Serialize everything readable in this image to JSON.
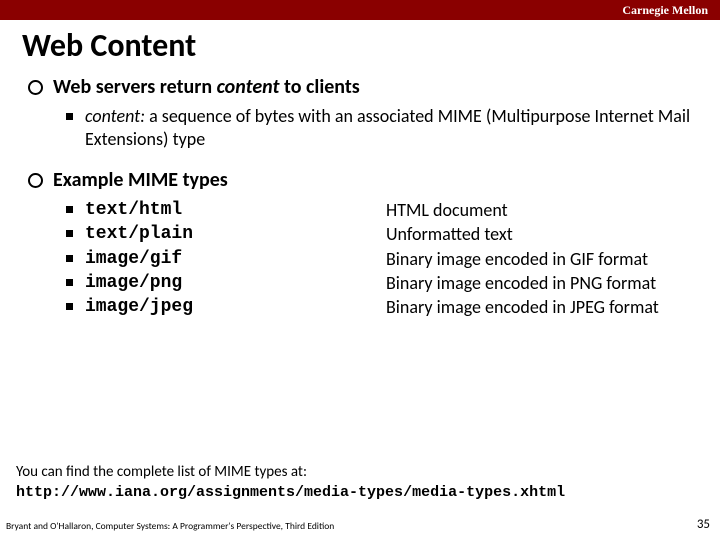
{
  "institution": "Carnegie Mellon",
  "title": "Web Content",
  "section1": {
    "heading_pre": "Web servers return ",
    "heading_em": "content",
    "heading_post": " to clients",
    "item_em": "content:",
    "item_rest": " a sequence of bytes with an associated MIME (Multipurpose Internet Mail Extensions) type"
  },
  "section2": {
    "heading": "Example MIME types",
    "rows": [
      {
        "type": "text/html",
        "desc": "HTML document"
      },
      {
        "type": "text/plain",
        "desc": "Unformatted text"
      },
      {
        "type": "image/gif",
        "desc": "Binary image encoded in GIF format"
      },
      {
        "type": "image/png",
        "desc": "Binary image encoded in PNG format"
      },
      {
        "type": "image/jpeg",
        "desc": "Binary image encoded in JPEG format"
      }
    ]
  },
  "footnote": {
    "text": "You can find the complete list of MIME types at:",
    "url": "http://www.iana.org/assignments/media-types/media-types.xhtml"
  },
  "footer_credit": "Bryant and O'Hallaron, Computer Systems: A Programmer's Perspective, Third Edition",
  "page_number": "35"
}
